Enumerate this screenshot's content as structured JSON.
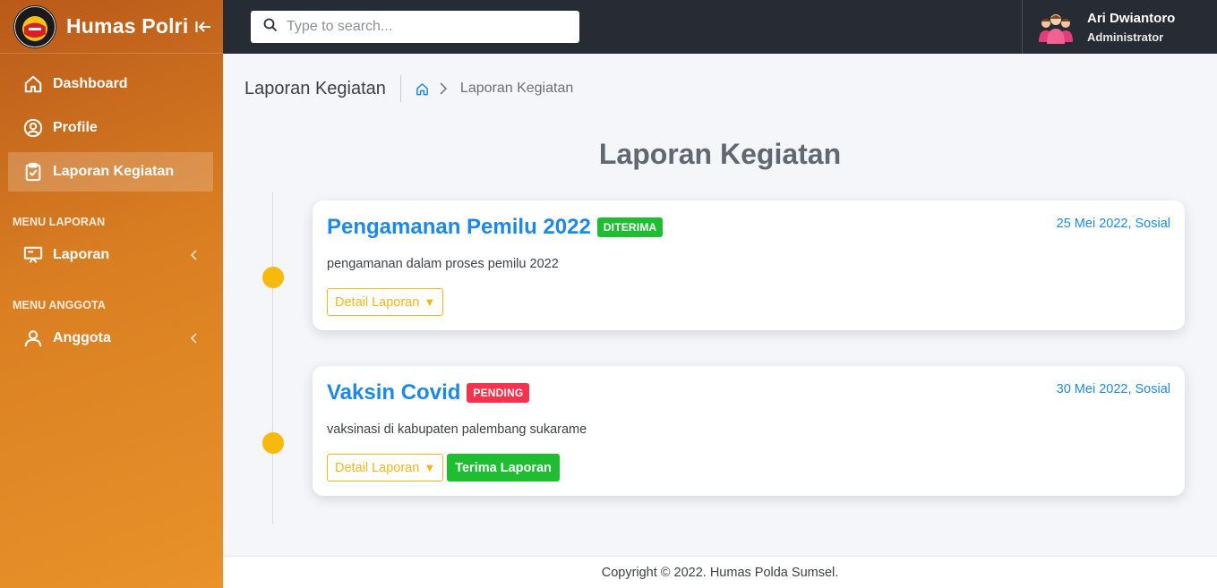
{
  "brand": {
    "title": "Humas Polri",
    "logo_ring_text": "DETEKTIF DIPERCAYA"
  },
  "sidebar": {
    "items": [
      {
        "label": "Dashboard"
      },
      {
        "label": "Profile"
      },
      {
        "label": "Laporan Kegiatan",
        "active": true
      }
    ],
    "sections": [
      {
        "header": "MENU LAPORAN",
        "items": [
          {
            "label": "Laporan"
          }
        ]
      },
      {
        "header": "MENU ANGGOTA",
        "items": [
          {
            "label": "Anggota"
          }
        ]
      }
    ]
  },
  "search": {
    "placeholder": "Type to search..."
  },
  "user": {
    "name": "Ari Dwiantoro",
    "role": "Administrator"
  },
  "page": {
    "title": "Laporan Kegiatan",
    "breadcrumb_current": "Laporan Kegiatan",
    "section_title": "Laporan Kegiatan"
  },
  "timeline": [
    {
      "title": "Pengamanan Pemilu 2022",
      "status": "DITERIMA",
      "status_color": "#1fbd32",
      "date": "25 Mei 2022, Sosial",
      "description": "pengamanan dalam proses pemilu 2022",
      "detail_label": "Detail Laporan",
      "detail_caret": "▼"
    },
    {
      "title": "Vaksin Covid",
      "status": "PENDING",
      "status_color": "#f4344f",
      "date": "30 Mei 2022, Sosial",
      "description": "vaksinasi di kabupaten palembang sukarame",
      "detail_label": "Detail Laporan",
      "detail_caret": "▼",
      "accept_label": "Terima Laporan"
    }
  ],
  "footer": {
    "text": "Copyright © 2022. Humas Polda Sumsel."
  },
  "colors": {
    "accent_blue": "#1e88e5",
    "timeline_dot": "#f7b90b",
    "outline_button": "#f2b51c",
    "topbar": "#272b33"
  }
}
